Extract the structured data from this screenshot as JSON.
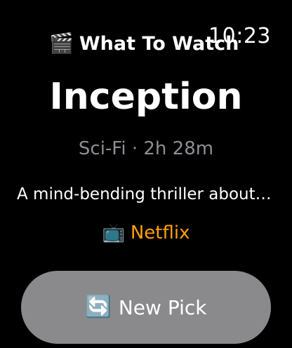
{
  "status_bar": {
    "time": "10:23"
  },
  "header": {
    "icon": "🎬",
    "icon_name": "clapper-board-icon",
    "title": "What To Watch"
  },
  "movie": {
    "title": "Inception",
    "meta": "Sci-Fi · 2h 28m",
    "description": "A mind-bending thriller about dream-sharing and stolen secrets.",
    "service_icon": "📺",
    "service_icon_name": "television-icon",
    "service": "Netflix"
  },
  "actions": {
    "new_pick_icon": "🔄",
    "new_pick_icon_name": "refresh-icon",
    "new_pick_label": "New Pick"
  },
  "colors": {
    "background": "#000000",
    "accent": "#ff9f0a",
    "secondary_text": "#8e8e93",
    "button_bg": "#8a8a8d"
  }
}
